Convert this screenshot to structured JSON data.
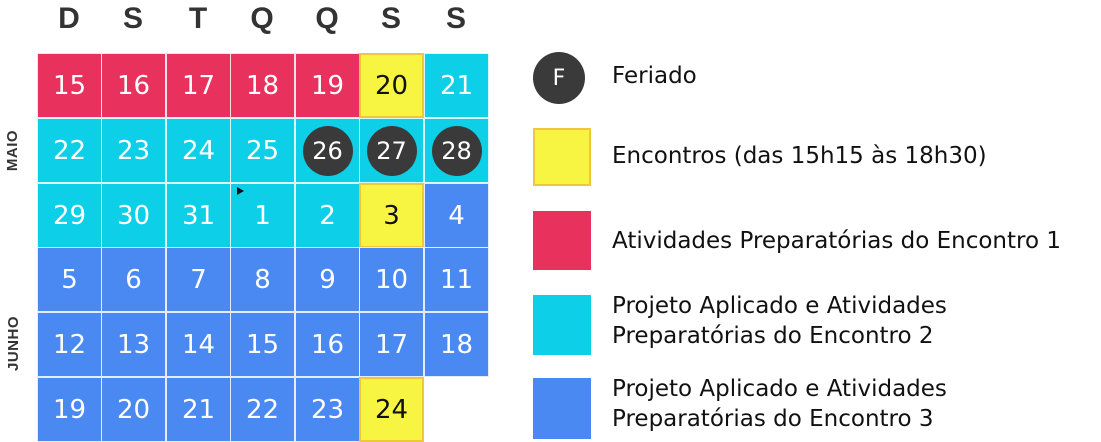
{
  "weekdays": [
    "D",
    "S",
    "T",
    "Q",
    "Q",
    "S",
    "S"
  ],
  "months": [
    "MAIO",
    "JUNHO"
  ],
  "calendar": [
    [
      "15",
      "16",
      "17",
      "18",
      "19",
      "20",
      "21"
    ],
    [
      "22",
      "23",
      "24",
      "25",
      "26",
      "27",
      "28"
    ],
    [
      "29",
      "30",
      "31",
      "1",
      "2",
      "3",
      "4"
    ],
    [
      "5",
      "6",
      "7",
      "8",
      "9",
      "10",
      "11"
    ],
    [
      "12",
      "13",
      "14",
      "15",
      "16",
      "17",
      "18"
    ],
    [
      "19",
      "20",
      "21",
      "22",
      "23",
      "24"
    ]
  ],
  "cell_types": [
    [
      "pink",
      "pink",
      "pink",
      "pink",
      "pink",
      "yellow",
      "cyan"
    ],
    [
      "cyan",
      "cyan",
      "cyan",
      "cyan",
      "holiday",
      "holiday",
      "holiday"
    ],
    [
      "cyan",
      "cyan",
      "cyan",
      "cyan",
      "cyan",
      "yellow",
      "blue"
    ],
    [
      "blue",
      "blue",
      "blue",
      "blue",
      "blue",
      "blue",
      "blue"
    ],
    [
      "blue",
      "blue",
      "blue",
      "blue",
      "blue",
      "blue",
      "blue"
    ],
    [
      "blue",
      "blue",
      "blue",
      "blue",
      "blue",
      "yellow"
    ]
  ],
  "legend": {
    "holiday_symbol": "F",
    "holiday": "Feriado",
    "encontros": "Encontros (das 15h15 às 18h30)",
    "enc1": "Atividades Preparatórias do Encontro 1",
    "enc2_line1": "Projeto Aplicado e Atividades",
    "enc2_line2": "Preparatórias do Encontro 2",
    "enc3_line1": "Projeto Aplicado e Atividades",
    "enc3_line2": "Preparatórias do Encontro 3"
  },
  "colors": {
    "pink": "#e8315c",
    "cyan": "#0dd0e8",
    "blue": "#4a89f2",
    "yellow": "#f7f541",
    "holiday": "#3a3a3a"
  }
}
